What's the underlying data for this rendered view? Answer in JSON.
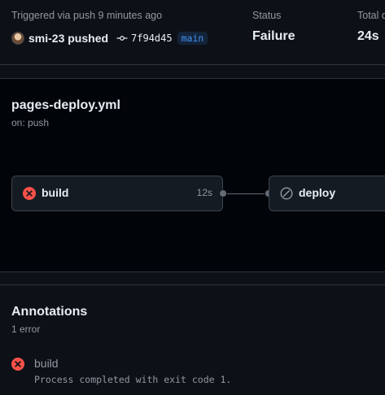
{
  "summary": {
    "trigger_label": "Triggered via push 9 minutes ago",
    "actor": "smi-23",
    "action": "pushed",
    "commit_sha": "7f94d45",
    "branch": "main",
    "status_label": "Status",
    "status_value": "Failure",
    "total_label": "Total duration",
    "total_value": "24s"
  },
  "workflow": {
    "name": "pages-deploy.yml",
    "trigger": "on: push",
    "jobs": [
      {
        "name": "build",
        "duration": "12s",
        "state": "failed",
        "icon": "x-circle-fill-icon"
      },
      {
        "name": "deploy",
        "duration": "",
        "state": "skipped",
        "icon": "skip-icon"
      }
    ]
  },
  "annotations": {
    "title": "Annotations",
    "count": "1 error",
    "items": [
      {
        "job": "build",
        "message": "Process completed with exit code 1.",
        "icon": "x-circle-fill-icon"
      }
    ]
  },
  "colors": {
    "background": "#0d1117",
    "graph_background": "#010409",
    "border": "#30363d",
    "card": "#151b23",
    "text_primary": "#e6edf3",
    "text_muted": "#9198a1",
    "danger": "#f85149",
    "accent": "#4493f8"
  }
}
